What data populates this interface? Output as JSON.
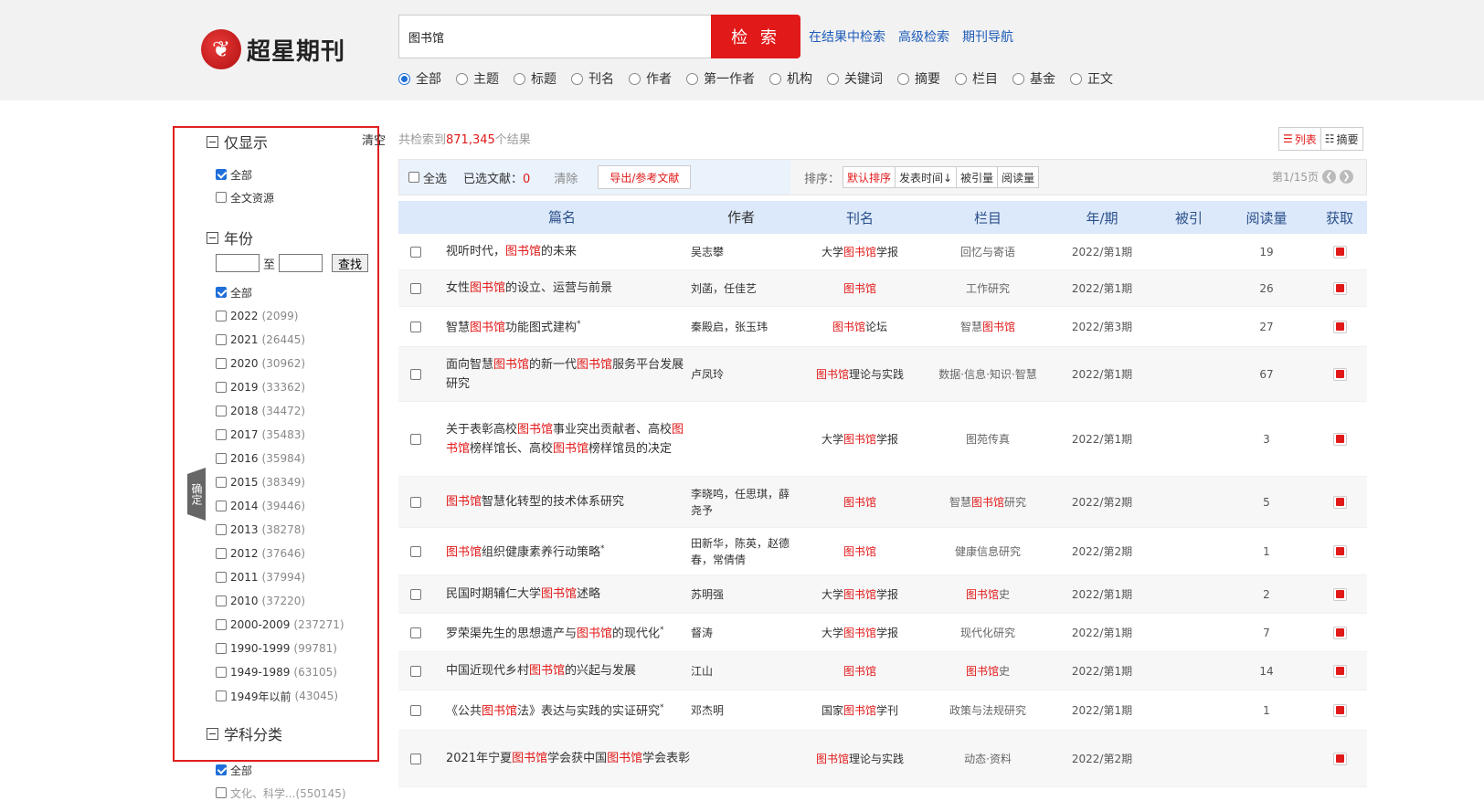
{
  "header": {
    "logo_text": "超星期刊",
    "logo_mark": "❦",
    "search_value": "图书馆",
    "search_button": "检 索",
    "links": [
      "在结果中检索",
      "高级检索",
      "期刊导航"
    ],
    "scopes": [
      "全部",
      "主题",
      "标题",
      "刊名",
      "作者",
      "第一作者",
      "机构",
      "关键词",
      "摘要",
      "栏目",
      "基金",
      "正文"
    ]
  },
  "sidebar": {
    "only_show_title": "仅显示",
    "clear": "清空",
    "only_show": [
      {
        "label": "全部",
        "checked": true
      },
      {
        "label": "全文资源",
        "checked": false
      }
    ],
    "year_title": "年份",
    "year_to": "至",
    "year_find": "查找",
    "years": [
      {
        "label": "全部",
        "count": "",
        "checked": true
      },
      {
        "label": "2022",
        "count": "(2099)"
      },
      {
        "label": "2021",
        "count": "(26445)"
      },
      {
        "label": "2020",
        "count": "(30962)"
      },
      {
        "label": "2019",
        "count": "(33362)"
      },
      {
        "label": "2018",
        "count": "(34472)"
      },
      {
        "label": "2017",
        "count": "(35483)"
      },
      {
        "label": "2016",
        "count": "(35984)"
      },
      {
        "label": "2015",
        "count": "(38349)"
      },
      {
        "label": "2014",
        "count": "(39446)"
      },
      {
        "label": "2013",
        "count": "(38278)"
      },
      {
        "label": "2012",
        "count": "(37646)"
      },
      {
        "label": "2011",
        "count": "(37994)"
      },
      {
        "label": "2010",
        "count": "(37220)"
      },
      {
        "label": "2000-2009",
        "count": "(237271)"
      },
      {
        "label": "1990-1999",
        "count": "(99781)"
      },
      {
        "label": "1949-1989",
        "count": "(63105)"
      },
      {
        "label": "1949年以前",
        "count": "(43045)"
      }
    ],
    "subject_title": "学科分类",
    "subject_all": "全部",
    "subject_partial": "文化、科学...(550145)",
    "confirm": "确定"
  },
  "results": {
    "prefix": "共检索到",
    "count": "871,345",
    "suffix": "个结果",
    "view_list": "列表",
    "view_summary": "摘要"
  },
  "toolbar": {
    "select_all": "全选",
    "selected_label": "已选文献：",
    "selected_count": "0",
    "clear": "清除",
    "export": "导出/参考文献",
    "sort_label": "排序：",
    "sorts": [
      "默认排序",
      "发表时间↓",
      "被引量",
      "阅读量"
    ],
    "page": "第1/15页"
  },
  "table": {
    "headers": [
      "篇名",
      "作者",
      "刊名",
      "栏目",
      "年/期",
      "被引",
      "阅读量",
      "获取"
    ],
    "rows": [
      {
        "title": [
          [
            "视听时代，",
            0
          ],
          [
            "图书馆",
            1
          ],
          [
            "的未来",
            0
          ]
        ],
        "star": false,
        "author": "吴志攀",
        "journal": [
          [
            "大学",
            0
          ],
          [
            "图书馆",
            1
          ],
          [
            "学报",
            0
          ]
        ],
        "column": [
          [
            "回忆与寄语",
            0
          ]
        ],
        "year": "2022/第1期",
        "cited": "",
        "reads": "19",
        "h": 40
      },
      {
        "title": [
          [
            "女性",
            0
          ],
          [
            "图书馆",
            1
          ],
          [
            "的设立、运营与前景",
            0
          ]
        ],
        "star": false,
        "author": "刘菡，任佳艺",
        "journal": [
          [
            "图书馆",
            1
          ]
        ],
        "column": [
          [
            "工作研究",
            0
          ]
        ],
        "year": "2022/第1期",
        "cited": "",
        "reads": "26",
        "h": 40
      },
      {
        "title": [
          [
            "智慧",
            0
          ],
          [
            "图书馆",
            1
          ],
          [
            "功能图式建构",
            0
          ]
        ],
        "star": true,
        "author": "秦殿启，张玉玮",
        "journal": [
          [
            "图书馆",
            1
          ],
          [
            "论坛",
            0
          ]
        ],
        "column": [
          [
            "智慧",
            0
          ],
          [
            "图书馆",
            1
          ]
        ],
        "year": "2022/第3期",
        "cited": "",
        "reads": "27",
        "h": 44
      },
      {
        "title": [
          [
            "面向智慧",
            0
          ],
          [
            "图书馆",
            1
          ],
          [
            "的新一代",
            0
          ],
          [
            "图书馆",
            1
          ],
          [
            "服务平台发展研究",
            0
          ]
        ],
        "star": false,
        "author": "卢凤玲",
        "journal": [
          [
            "图书馆",
            1
          ],
          [
            "理论与实践",
            0
          ]
        ],
        "column": [
          [
            "数据·信息·知识·智慧",
            0
          ]
        ],
        "year": "2022/第1期",
        "cited": "",
        "reads": "67",
        "h": 60
      },
      {
        "title": [
          [
            "关于表彰高校",
            0
          ],
          [
            "图书馆",
            1
          ],
          [
            "事业突出贡献者、高校",
            0
          ],
          [
            "图书馆",
            1
          ],
          [
            "榜样馆长、高校",
            0
          ],
          [
            "图书馆",
            1
          ],
          [
            "榜样馆员的决定",
            0
          ]
        ],
        "star": false,
        "author": "",
        "journal": [
          [
            "大学",
            0
          ],
          [
            "图书馆",
            1
          ],
          [
            "学报",
            0
          ]
        ],
        "column": [
          [
            "图苑传真",
            0
          ]
        ],
        "year": "2022/第1期",
        "cited": "",
        "reads": "3",
        "h": 82
      },
      {
        "title": [
          [
            "图书馆",
            1
          ],
          [
            "智慧化转型的技术体系研究",
            0
          ]
        ],
        "star": false,
        "author": "李晓鸣，任思琪，薛尧予",
        "journal": [
          [
            "图书馆",
            1
          ]
        ],
        "column": [
          [
            "智慧",
            0
          ],
          [
            "图书馆",
            1
          ],
          [
            "研究",
            0
          ]
        ],
        "year": "2022/第2期",
        "cited": "",
        "reads": "5",
        "h": 56
      },
      {
        "title": [
          [
            "图书馆",
            1
          ],
          [
            "组织健康素养行动策略",
            0
          ]
        ],
        "star": true,
        "author": "田新华，陈英，赵德春，常倩倩",
        "journal": [
          [
            "图书馆",
            1
          ]
        ],
        "column": [
          [
            "健康信息研究",
            0
          ]
        ],
        "year": "2022/第2期",
        "cited": "",
        "reads": "1",
        "h": 52
      },
      {
        "title": [
          [
            "民国时期辅仁大学",
            0
          ],
          [
            "图书馆",
            1
          ],
          [
            "述略",
            0
          ]
        ],
        "star": false,
        "author": "苏明强",
        "journal": [
          [
            "大学",
            0
          ],
          [
            "图书馆",
            1
          ],
          [
            "学报",
            0
          ]
        ],
        "column": [
          [
            "图书馆",
            1
          ],
          [
            "史",
            0
          ]
        ],
        "year": "2022/第1期",
        "cited": "",
        "reads": "2",
        "h": 42
      },
      {
        "title": [
          [
            "罗荣渠先生的思想遗产与",
            0
          ],
          [
            "图书馆",
            1
          ],
          [
            "的现代化",
            0
          ]
        ],
        "star": true,
        "author": "督涛",
        "journal": [
          [
            "大学",
            0
          ],
          [
            "图书馆",
            1
          ],
          [
            "学报",
            0
          ]
        ],
        "column": [
          [
            "现代化研究",
            0
          ]
        ],
        "year": "2022/第1期",
        "cited": "",
        "reads": "7",
        "h": 42
      },
      {
        "title": [
          [
            "中国近现代乡村",
            0
          ],
          [
            "图书馆",
            1
          ],
          [
            "的兴起与发展",
            0
          ]
        ],
        "star": false,
        "author": "江山",
        "journal": [
          [
            "图书馆",
            1
          ]
        ],
        "column": [
          [
            "图书馆",
            1
          ],
          [
            "史",
            0
          ]
        ],
        "year": "2022/第1期",
        "cited": "",
        "reads": "14",
        "h": 42
      },
      {
        "title": [
          [
            "《公共",
            0
          ],
          [
            "图书馆",
            1
          ],
          [
            "法》表达与实践的实证研究",
            0
          ]
        ],
        "star": true,
        "author": "邓杰明",
        "journal": [
          [
            "国家",
            0
          ],
          [
            "图书馆",
            1
          ],
          [
            "学刊",
            0
          ]
        ],
        "column": [
          [
            "政策与法规研究",
            0
          ]
        ],
        "year": "2022/第1期",
        "cited": "",
        "reads": "1",
        "h": 44
      },
      {
        "title": [
          [
            "2021年宁夏",
            0
          ],
          [
            "图书馆",
            1
          ],
          [
            "学会获中国",
            0
          ],
          [
            "图书馆",
            1
          ],
          [
            "学会表彰",
            0
          ]
        ],
        "star": false,
        "author": "",
        "journal": [
          [
            "图书馆",
            1
          ],
          [
            "理论与实践",
            0
          ]
        ],
        "column": [
          [
            "动态·资料",
            0
          ]
        ],
        "year": "2022/第2期",
        "cited": "",
        "reads": "",
        "h": 62
      }
    ]
  }
}
